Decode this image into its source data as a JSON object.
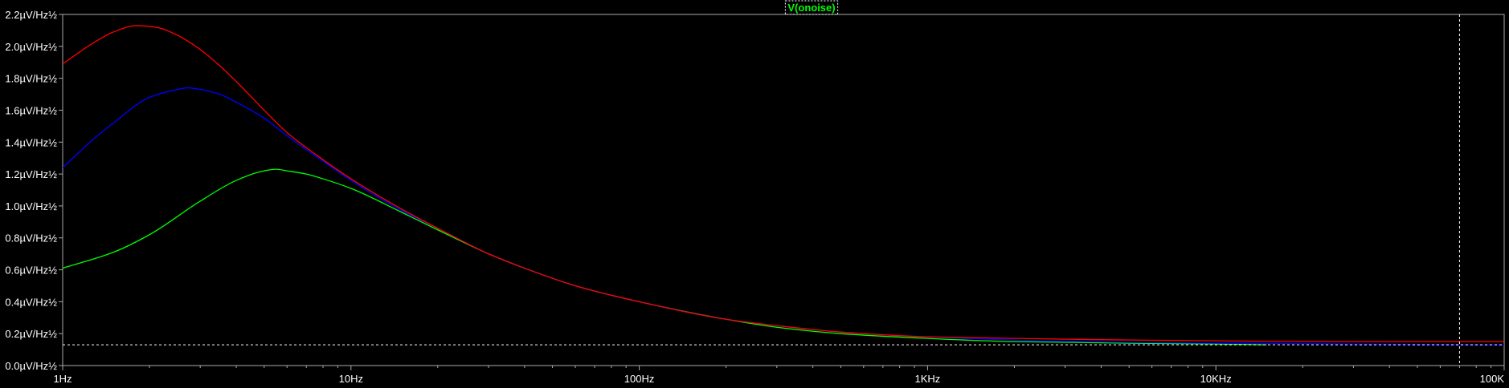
{
  "colors": {
    "background": "#000000",
    "axis": "#aaaaaa",
    "tick_text": "#ffffff",
    "legend_text": "#00ff00",
    "cursor": "#ffffff"
  },
  "legend": {
    "label": "V(onoise)"
  },
  "chart_data": {
    "type": "line",
    "title": "",
    "xlabel": "",
    "ylabel": "",
    "x_scale": "log",
    "xlim": [
      1,
      100000
    ],
    "ylim": [
      0,
      2.2
    ],
    "grid": false,
    "legend_position": "top-center",
    "x_ticks": [
      {
        "value": 1,
        "label": "1Hz"
      },
      {
        "value": 10,
        "label": "10Hz"
      },
      {
        "value": 100,
        "label": "100Hz"
      },
      {
        "value": 1000,
        "label": "1KHz"
      },
      {
        "value": 10000,
        "label": "10KHz"
      },
      {
        "value": 100000,
        "label": "100K"
      }
    ],
    "y_ticks": [
      {
        "value": 0.0,
        "label": "0.0µV/Hz½"
      },
      {
        "value": 0.2,
        "label": "0.2µV/Hz½"
      },
      {
        "value": 0.4,
        "label": "0.4µV/Hz½"
      },
      {
        "value": 0.6,
        "label": "0.6µV/Hz½"
      },
      {
        "value": 0.8,
        "label": "0.8µV/Hz½"
      },
      {
        "value": 1.0,
        "label": "1.0µV/Hz½"
      },
      {
        "value": 1.2,
        "label": "1.2µV/Hz½"
      },
      {
        "value": 1.4,
        "label": "1.4µV/Hz½"
      },
      {
        "value": 1.6,
        "label": "1.6µV/Hz½"
      },
      {
        "value": 1.8,
        "label": "1.8µV/Hz½"
      },
      {
        "value": 2.0,
        "label": "2.0µV/Hz½"
      },
      {
        "value": 2.2,
        "label": "2.2µV/Hz½"
      }
    ],
    "series": [
      {
        "color": "#ff0000",
        "x": [
          1,
          1.3,
          1.5,
          1.8,
          2.1,
          2.5,
          3,
          3.5,
          4,
          5,
          6,
          8,
          10,
          15,
          20,
          30,
          40,
          60,
          100,
          200,
          300,
          500,
          1000,
          2000,
          5000,
          10000,
          30000,
          100000
        ],
        "y": [
          1.89,
          2.03,
          2.09,
          2.13,
          2.12,
          2.07,
          1.98,
          1.88,
          1.78,
          1.6,
          1.46,
          1.29,
          1.17,
          0.98,
          0.86,
          0.7,
          0.61,
          0.5,
          0.4,
          0.29,
          0.25,
          0.21,
          0.18,
          0.17,
          0.16,
          0.155,
          0.15,
          0.15
        ]
      },
      {
        "color": "#0000ff",
        "x": [
          1,
          1.3,
          1.5,
          2,
          2.5,
          2.7,
          3,
          3.5,
          4,
          5,
          6,
          8,
          10,
          15,
          20,
          30,
          40,
          60,
          100,
          200,
          300,
          500,
          1000,
          2000,
          5000,
          10000,
          30000,
          100000
        ],
        "y": [
          1.24,
          1.43,
          1.52,
          1.68,
          1.73,
          1.74,
          1.73,
          1.7,
          1.65,
          1.55,
          1.44,
          1.28,
          1.16,
          0.97,
          0.86,
          0.7,
          0.61,
          0.5,
          0.4,
          0.29,
          0.25,
          0.21,
          0.18,
          0.16,
          0.145,
          0.14,
          0.135,
          0.13
        ]
      },
      {
        "color": "#00ff00",
        "x": [
          1,
          1.5,
          2,
          3,
          4,
          5,
          5.5,
          6,
          7,
          8,
          10,
          15,
          20,
          30,
          40,
          60,
          100,
          200,
          300,
          500,
          1000,
          2000,
          5000,
          10000,
          15000
        ],
        "y": [
          0.61,
          0.71,
          0.82,
          1.03,
          1.16,
          1.22,
          1.23,
          1.22,
          1.2,
          1.17,
          1.11,
          0.96,
          0.85,
          0.7,
          0.61,
          0.5,
          0.4,
          0.29,
          0.24,
          0.2,
          0.17,
          0.15,
          0.14,
          0.135,
          0.13
        ]
      }
    ],
    "cursors": [
      {
        "orientation": "vertical",
        "x": 70000
      },
      {
        "orientation": "horizontal",
        "y": 0.13
      }
    ]
  }
}
